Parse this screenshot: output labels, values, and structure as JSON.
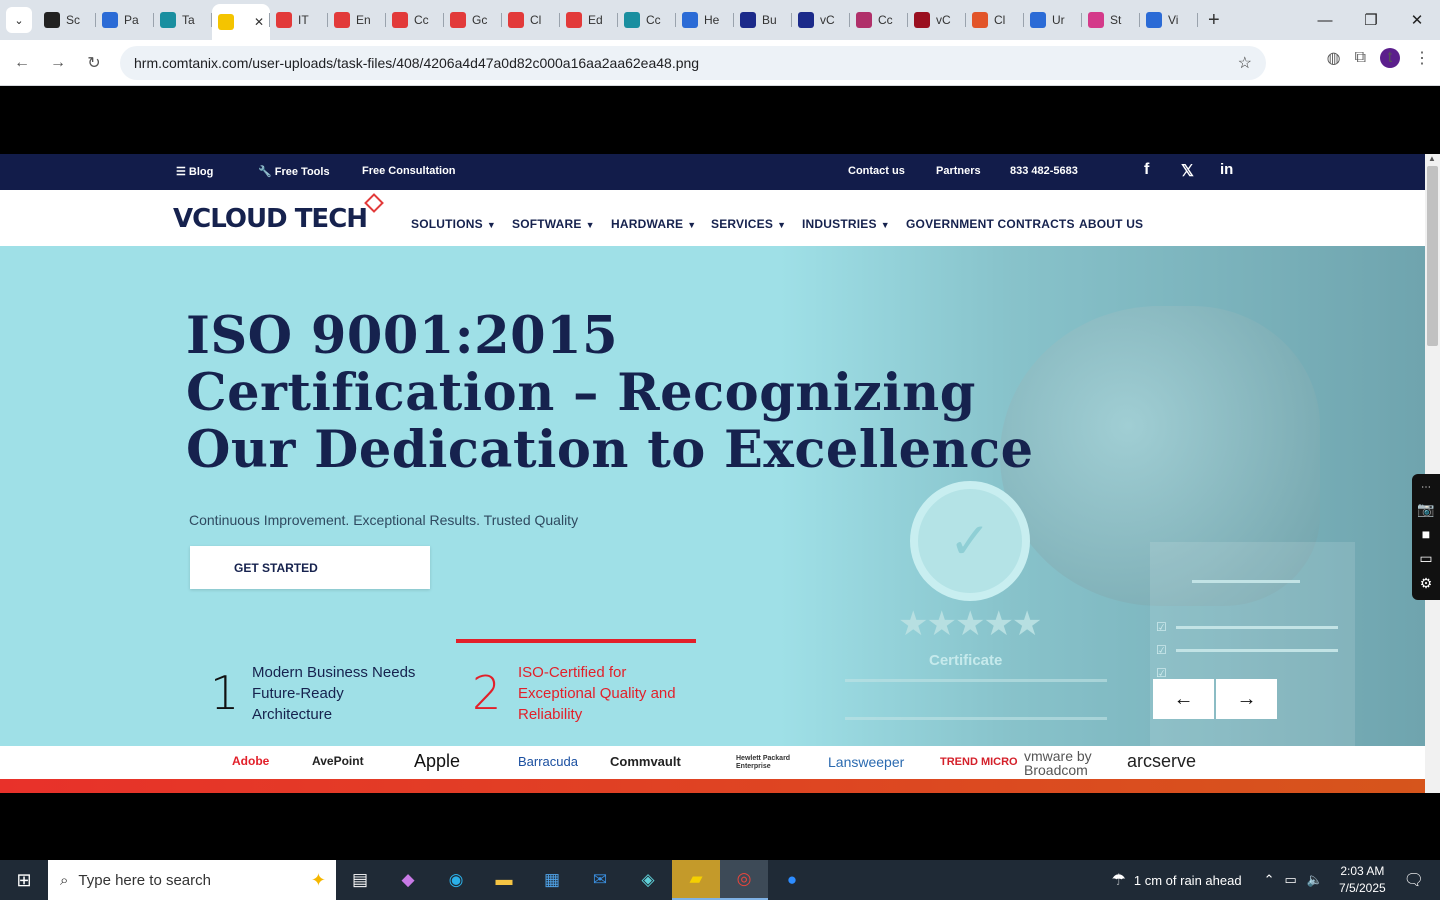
{
  "browser": {
    "tabs": [
      {
        "label": "Sc",
        "icon": "dark-circle-icon",
        "color": "#222222"
      },
      {
        "label": "Pa",
        "icon": "arc-icon",
        "color": "#2b6bd6"
      },
      {
        "label": "Ta",
        "icon": "teal-circle-icon",
        "color": "#1a8fa0"
      },
      {
        "label": "",
        "icon": "w-icon",
        "color": "#f4c400",
        "active": true
      },
      {
        "label": "IT",
        "icon": "red-tag-icon",
        "color": "#e23a3a"
      },
      {
        "label": "En",
        "icon": "red-tag-icon",
        "color": "#e23a3a"
      },
      {
        "label": "Cc",
        "icon": "red-tag-icon",
        "color": "#e23a3a"
      },
      {
        "label": "Gc",
        "icon": "red-tag-icon",
        "color": "#e23a3a"
      },
      {
        "label": "Cl",
        "icon": "red-tag-icon",
        "color": "#e23a3a"
      },
      {
        "label": "Ed",
        "icon": "red-tag-icon",
        "color": "#e23a3a"
      },
      {
        "label": "Cc",
        "icon": "teal-circle-icon",
        "color": "#1a8fa0"
      },
      {
        "label": "He",
        "icon": "scale-icon",
        "color": "#2b6bd6"
      },
      {
        "label": "Bu",
        "icon": "x-icon",
        "color": "#1b2a8a"
      },
      {
        "label": "vC",
        "icon": "check-icon",
        "color": "#1b2a8a"
      },
      {
        "label": "Cc",
        "icon": "flower-icon",
        "color": "#b0306a"
      },
      {
        "label": "vC",
        "icon": "v-icon",
        "color": "#9a1020"
      },
      {
        "label": "Cl",
        "icon": "pen-icon",
        "color": "#e2552a"
      },
      {
        "label": "Ur",
        "icon": "doc-icon",
        "color": "#2b6bd6"
      },
      {
        "label": "St",
        "icon": "pin-icon",
        "color": "#d43a8a"
      },
      {
        "label": "Vi",
        "icon": "pulse-icon",
        "color": "#2b6bd6"
      }
    ],
    "new_tab": "+",
    "url": "hrm.comtanix.com/user-uploads/task-files/408/4206a4d47a0d82c000a16aa2aa62ea48.png",
    "profile_initial": "t"
  },
  "site": {
    "topbar": {
      "blog": "Blog",
      "free_tools": "Free Tools",
      "free_consultation": "Free Consultation",
      "contact": "Contact us",
      "partners": "Partners",
      "phone": "833 482-5683",
      "facebook": "f",
      "x": "𝕏",
      "linkedin": "in"
    },
    "logo": {
      "text": "VCLOUD TECH"
    },
    "nav": [
      {
        "label": "SOLUTIONS",
        "dropdown": true
      },
      {
        "label": "SOFTWARE",
        "dropdown": true
      },
      {
        "label": "HARDWARE",
        "dropdown": true
      },
      {
        "label": "SERVICES",
        "dropdown": true
      },
      {
        "label": "INDUSTRIES",
        "dropdown": true
      },
      {
        "label": "GOVERNMENT CONTRACTS",
        "dropdown": false
      },
      {
        "label": "ABOUT US",
        "dropdown": false
      }
    ],
    "hero": {
      "title_line1": "ISO 9001:2015",
      "title_line2": "Certification – Recognizing",
      "title_line3": "Our Dedication to Excellence",
      "subtitle": "Continuous Improvement. Exceptional Results. Trusted Quality",
      "cta": "GET STARTED",
      "certificate_label": "Certificate",
      "slides": [
        {
          "num": "1",
          "text_l1": "Modern Business Needs",
          "text_l2": "Future-Ready",
          "text_l3": "Architecture"
        },
        {
          "num": "2",
          "text_l1": "ISO-Certified for",
          "text_l2": "Exceptional Quality and",
          "text_l3": "Reliability"
        }
      ],
      "prev": "←",
      "next": "→"
    },
    "brands": [
      "Adobe",
      "AvePoint",
      "Apple",
      "Barracuda",
      "Commvault",
      "Hewlett Packard Enterprise",
      "Lansweeper",
      "TREND MICRO",
      "vmware by Broadcom",
      "arcserve"
    ],
    "colors": {
      "navy": "#16224e",
      "red": "#e2202a",
      "hero_bg": "#9fe0e7"
    }
  },
  "taskbar": {
    "search_placeholder": "Type here to search",
    "weather": "1 cm of rain ahead",
    "time": "2:03 AM",
    "date": "7/5/2025"
  }
}
